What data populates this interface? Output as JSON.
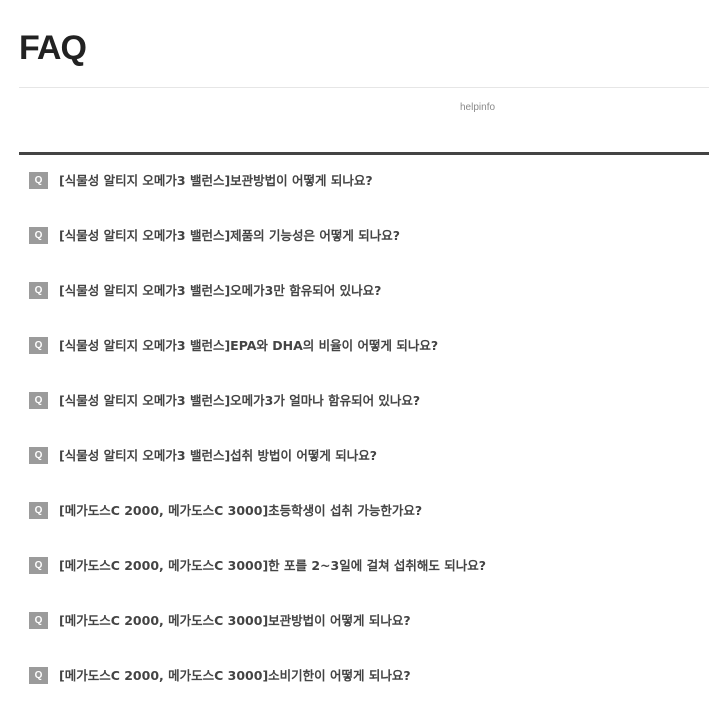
{
  "page": {
    "title": "FAQ",
    "subtitle": "helpinfo"
  },
  "faq": {
    "badge": "Q",
    "items": [
      "[식물성 알티지 오메가3 밸런스]보관방법이 어떻게 되나요?",
      "[식물성 알티지 오메가3 밸런스]제품의 기능성은 어떻게 되나요?",
      "[식물성 알티지 오메가3 밸런스]오메가3만 함유되어 있나요?",
      "[식물성 알티지 오메가3 밸런스]EPA와 DHA의 비율이 어떻게 되나요?",
      "[식물성 알티지 오메가3 밸런스]오메가3가 얼마나 함유되어 있나요?",
      "[식물성 알티지 오메가3 밸런스]섭취 방법이 어떻게 되나요?",
      "[메가도스C 2000, 메가도스C 3000]초등학생이 섭취 가능한가요?",
      "[메가도스C 2000, 메가도스C 3000]한 포를 2~3일에 걸쳐 섭취해도 되나요?",
      "[메가도스C 2000, 메가도스C 3000]보관방법이 어떻게 되나요?",
      "[메가도스C 2000, 메가도스C 3000]소비기한이 어떻게 되나요?"
    ]
  },
  "colors": {
    "badge_bg": "#9b9b9b",
    "top_border": "#444444",
    "question_text": "#444444"
  }
}
